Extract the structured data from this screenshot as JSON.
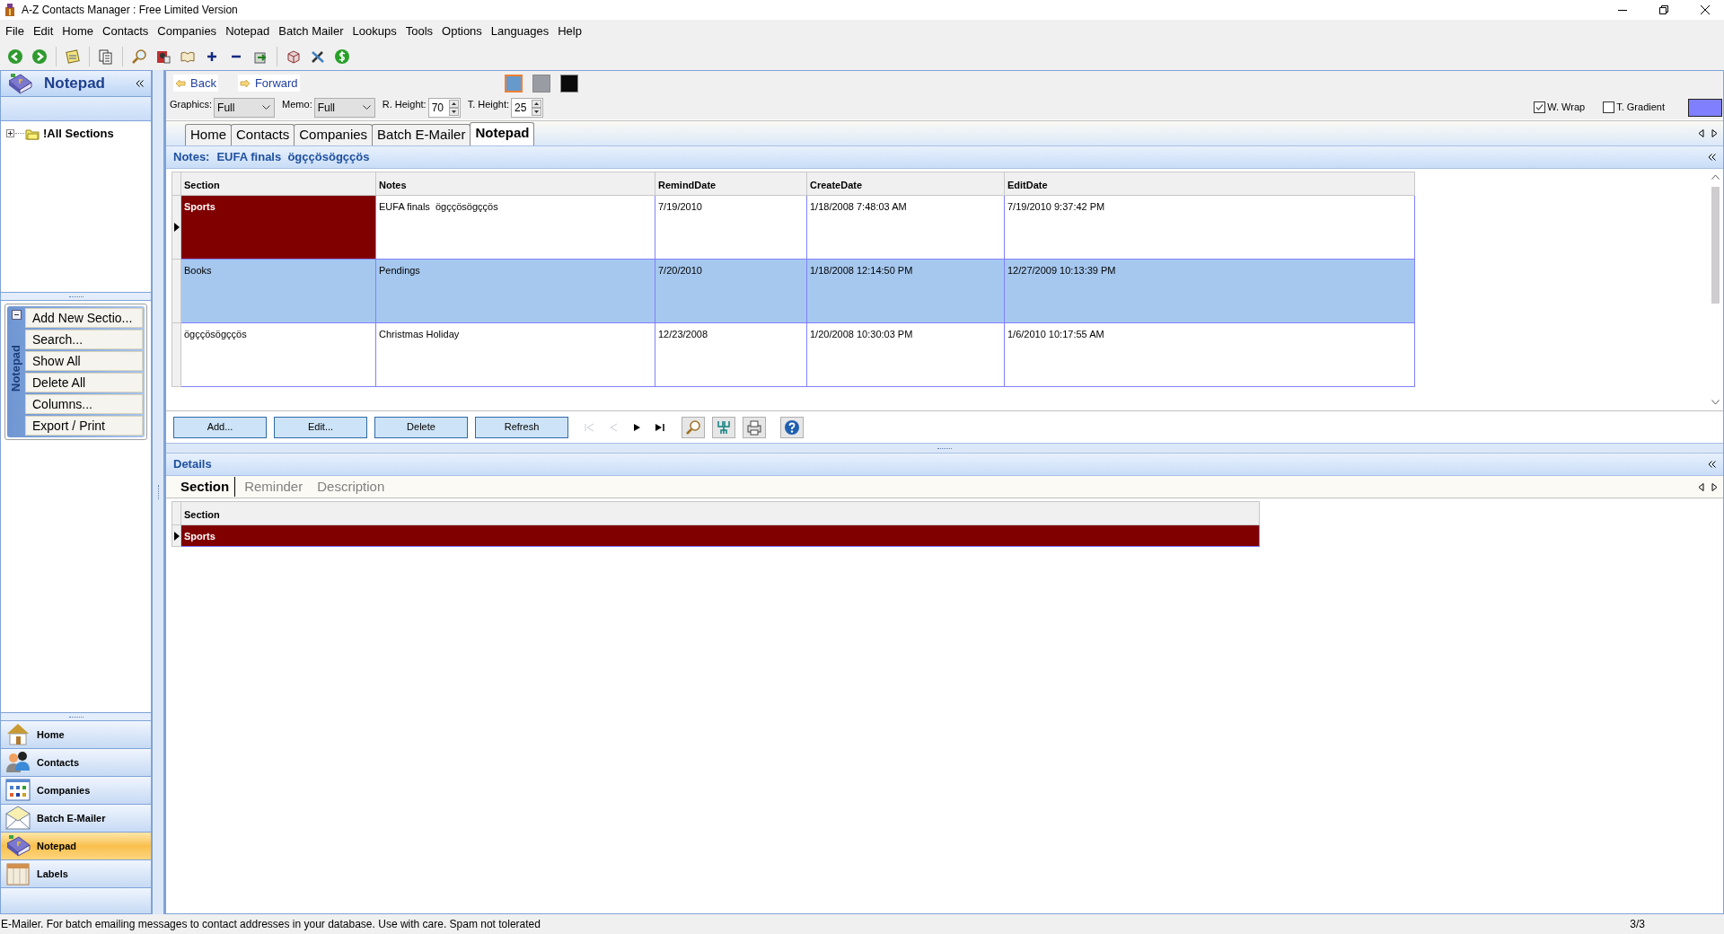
{
  "window": {
    "title": "A-Z Contacts Manager : Free Limited Version"
  },
  "menu": [
    "File",
    "Edit",
    "Home",
    "Contacts",
    "Companies",
    "Notepad",
    "Batch Mailer",
    "Lookups",
    "Tools",
    "Options",
    "Languages",
    "Help"
  ],
  "sidebar": {
    "title": "Notepad",
    "tree": [
      {
        "label": "!All Sections",
        "expanded": false
      }
    ],
    "task_panel": {
      "title": "Notepad",
      "expanded": true,
      "items": [
        "Add New Sectio...",
        "Search...",
        "Show All",
        "Delete All",
        "Columns...",
        "Export / Print"
      ]
    },
    "nav": [
      {
        "label": "Home",
        "selected": false
      },
      {
        "label": "Contacts",
        "selected": false
      },
      {
        "label": "Companies",
        "selected": false
      },
      {
        "label": "Batch E-Mailer",
        "selected": false
      },
      {
        "label": "Notepad",
        "selected": true
      },
      {
        "label": "Labels",
        "selected": false
      }
    ]
  },
  "navigation": {
    "back": "Back",
    "forward": "Forward"
  },
  "swatches": [
    {
      "color": "#6699cc",
      "selected": true
    },
    {
      "color": "#999ca3",
      "selected": false
    },
    {
      "color": "#0a0a0a",
      "selected": false
    }
  ],
  "options": {
    "fields": [
      {
        "label": "Graphics:",
        "value": "Full",
        "kind": "dropdown"
      },
      {
        "label": "Memo:",
        "value": "Full",
        "kind": "dropdown"
      },
      {
        "label": "R. Height:",
        "value": "70",
        "kind": "spinner"
      },
      {
        "label": "T. Height:",
        "value": "25",
        "kind": "spinner"
      }
    ],
    "checkboxes": [
      {
        "label": "W. Wrap",
        "checked": true
      },
      {
        "label": "T. Gradient",
        "checked": false
      }
    ]
  },
  "tabs": [
    {
      "label": "Home",
      "selected": false
    },
    {
      "label": "Contacts",
      "selected": false
    },
    {
      "label": "Companies",
      "selected": false
    },
    {
      "label": "Batch E-Mailer",
      "selected": false
    },
    {
      "label": "Notepad",
      "selected": true
    }
  ],
  "notes_header": {
    "label": "Notes:",
    "value": "EUFA finals  ögççösögççös"
  },
  "table": {
    "columns": [
      "Section",
      "Notes",
      "RemindDate",
      "CreateDate",
      "EditDate"
    ],
    "rows": [
      {
        "cells": [
          "Sports",
          "EUFA finals  ögççösögççös",
          "7/19/2010",
          "1/18/2008 7:48:03 AM",
          "7/19/2010 9:37:42 PM"
        ],
        "current": true,
        "selected": false
      },
      {
        "cells": [
          "Books",
          "Pendings",
          "7/20/2010",
          "1/18/2008 12:14:50 PM",
          "12/27/2009 10:13:39 PM"
        ],
        "current": false,
        "selected": true
      },
      {
        "cells": [
          "ögççösögççös",
          "Christmas Holiday",
          "12/23/2008",
          "1/20/2008 10:30:03 PM",
          "1/6/2010 10:17:55 AM"
        ],
        "current": false,
        "selected": false
      }
    ]
  },
  "buttons": [
    "Add...",
    "Edit...",
    "Delete",
    "Refresh"
  ],
  "record_nav": [
    {
      "kind": "first",
      "disabled": true
    },
    {
      "kind": "prev",
      "disabled": true
    },
    {
      "kind": "next",
      "disabled": false
    },
    {
      "kind": "last",
      "disabled": false
    }
  ],
  "details": {
    "title": "Details",
    "tabs": [
      {
        "label": "Section",
        "selected": true
      },
      {
        "label": "Reminder",
        "selected": false
      },
      {
        "label": "Description",
        "selected": false
      }
    ],
    "table": {
      "columns": [
        "Section"
      ],
      "rows": [
        {
          "cells": [
            "Sports"
          ],
          "current": true
        }
      ]
    }
  },
  "status_bar": {
    "message": "E-Mailer. For batch emailing messages to contact addresses in your database. Use with care. Spam not tolerated",
    "position": "3/3"
  }
}
